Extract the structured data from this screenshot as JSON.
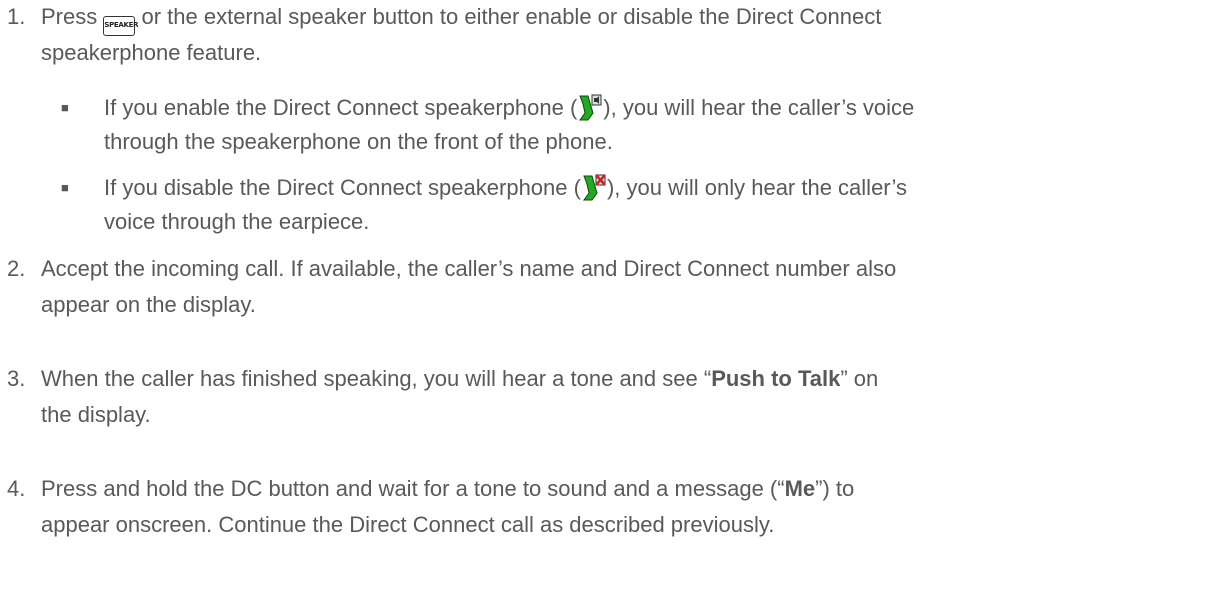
{
  "steps": [
    {
      "number": "1.",
      "pre": "Press ",
      "key_label": "SPEAKER",
      "post_line1": " or the external speaker button to either enable or disable the Direct Connect",
      "line2": "speakerphone feature."
    },
    {
      "number": "2.",
      "line1": "Accept the incoming call. If available, the caller’s name and Direct Connect number also",
      "line2": "appear on the display."
    },
    {
      "number": "3.",
      "pre": "When the caller has finished speaking, you will hear a tone and see “",
      "bold": "Push to Talk",
      "post": "” on",
      "line2": "the display."
    },
    {
      "number": "4.",
      "pre": "Press and hold the DC button and wait for a tone to sound and a message (“",
      "bold": "Me",
      "post": "”) to",
      "line2": "appear onscreen. Continue the Direct Connect call as described previously."
    }
  ],
  "bullets": [
    {
      "mark": "■",
      "pre": "If you enable the Direct Connect speakerphone (",
      "icon": "dc-speaker-on-icon",
      "post": "), you will hear the caller’s voice",
      "line2": "through the speakerphone on the front of the phone."
    },
    {
      "mark": "■",
      "pre": "If you disable the Direct Connect speakerphone (",
      "icon": "dc-speaker-off-icon",
      "post": "), you will only hear the caller’s",
      "line2": "voice through the earpiece."
    }
  ],
  "colors": {
    "text": "#58595b",
    "icon_green": "#22aa22",
    "icon_red": "#cc2222"
  }
}
